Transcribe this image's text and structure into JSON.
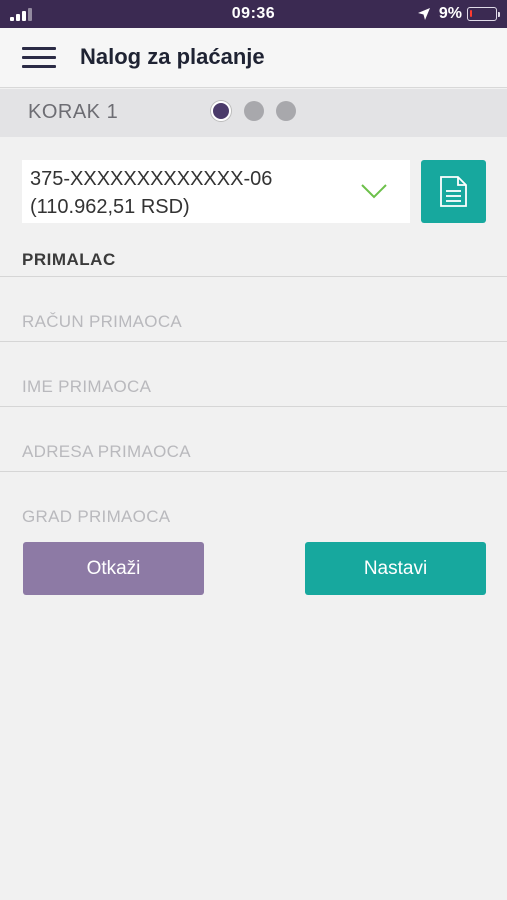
{
  "status_bar": {
    "time": "09:36",
    "battery_percent": "9%",
    "battery_level": 0.09,
    "battery_color": "#ff3b30",
    "icons": [
      "signal-icon",
      "location-icon",
      "battery-icon"
    ]
  },
  "header": {
    "title": "Nalog za plaćanje",
    "menu_icon": "hamburger-menu-icon"
  },
  "steps": {
    "label": "KORAK 1",
    "total": 3,
    "current": 1
  },
  "account": {
    "number": "375-XXXXXXXXXXXXX-06",
    "balance": "(110.962,51 RSD)",
    "chevron_icon": "chevron-down-icon",
    "doc_icon": "document-icon"
  },
  "recipient": {
    "section_title": "PRIMALAC",
    "fields": {
      "account": {
        "placeholder": "RAČUN PRIMAOCA",
        "value": ""
      },
      "name": {
        "placeholder": "IME PRIMAOCA",
        "value": ""
      },
      "address": {
        "placeholder": "ADRESA PRIMAOCA",
        "value": ""
      },
      "city": {
        "placeholder": "GRAD PRIMAOCA",
        "value": ""
      }
    }
  },
  "actions": {
    "cancel_label": "Otkaži",
    "continue_label": "Nastavi"
  },
  "colors": {
    "status_bar": "#3b2a52",
    "accent_teal": "#17a89e",
    "cancel_purple": "#8d7aa5",
    "active_dot": "#4b3b6a",
    "chevron_green": "#6cc04a"
  }
}
